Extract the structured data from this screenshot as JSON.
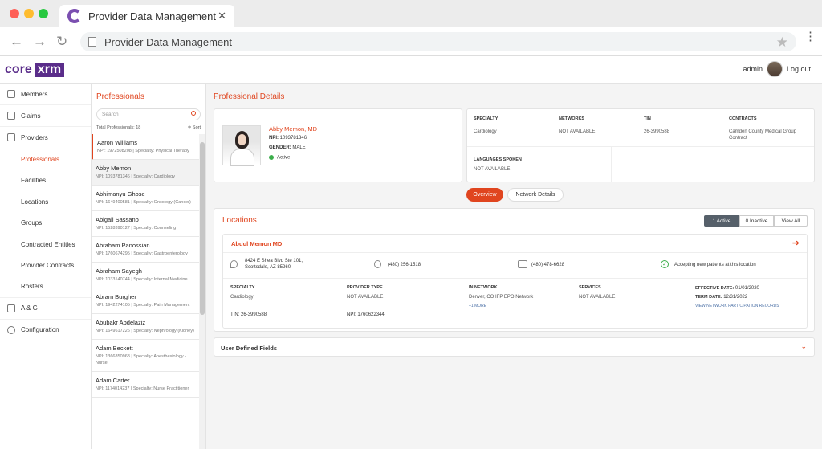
{
  "browser": {
    "tab_title": "Provider Data Management",
    "tab_close": "✕",
    "address": "Provider Data Management",
    "back": "←",
    "forward": "→",
    "reload": "↻",
    "star": "★",
    "menu": "⋮"
  },
  "header": {
    "brand_core": "core",
    "brand_xrm": "xrm",
    "user": "admin",
    "logout": "Log out"
  },
  "sidebar": {
    "members": "Members",
    "claims": "Claims",
    "providers": "Providers",
    "professionals": "Professionals",
    "facilities": "Facilities",
    "locations": "Locations",
    "groups": "Groups",
    "contracted_entities": "Contracted Entities",
    "provider_contracts": "Provider Contracts",
    "rosters": "Rosters",
    "a_and_g": "A & G",
    "configuration": "Configuration"
  },
  "professionals": {
    "title": "Professionals",
    "search_placeholder": "Search",
    "total": "Total Professionals: 18",
    "sort": "≑ Sort",
    "items": [
      {
        "name": "Aaron Williams",
        "meta": "NPI: 1972508208 | Specialty: Physical Therapy"
      },
      {
        "name": "Abby Memon",
        "meta": "NPI: 1093781346 | Specialty: Cardiology"
      },
      {
        "name": "Abhimanyu Ghose",
        "meta": "NPI: 1649400581 | Specialty: Oncology (Cancer)"
      },
      {
        "name": "Abigail Sassano",
        "meta": "NPI: 1528390127 | Specialty: Counseling"
      },
      {
        "name": "Abraham Panossian",
        "meta": "NPI: 1760674295 | Specialty: Gastroenterology"
      },
      {
        "name": "Abraham Sayegh",
        "meta": "NPI: 1033140744 | Specialty: Internal Medicine"
      },
      {
        "name": "Abram Burgher",
        "meta": "NPI: 1942274105 | Specialty: Pain Management"
      },
      {
        "name": "Abubakr Abdelaziz",
        "meta": "NPI: 1649617226 | Specialty: Nephrology (Kidney)"
      },
      {
        "name": "Adam Beckett",
        "meta": "NPI: 1366850968 | Specialty: Anesthesiology - Nurse"
      },
      {
        "name": "Adam Carter",
        "meta": "NPI: 1174014237 | Specialty: Nurse Practitioner"
      }
    ]
  },
  "details": {
    "title": "Professional Details",
    "name": "Abby Memon, MD",
    "npi_label": "NPI:",
    "npi": "1093781346",
    "gender_label": "GENDER:",
    "gender": "MALE",
    "status": "Active",
    "specialty_label": "SPECIALTY",
    "specialty": "Cardiology",
    "networks_label": "NETWORKS",
    "networks": "NOT AVAILABLE",
    "tin_label": "TIN",
    "tin": "26-3990588",
    "contracts_label": "CONTRACTS",
    "contracts": "Camden County Medical Group Contract",
    "languages_label": "LANGUAGES SPOKEN",
    "languages": "NOT AVAILABLE"
  },
  "tabs": {
    "overview": "Overview",
    "network_details": "Network Details"
  },
  "locations": {
    "title": "Locations",
    "filter_active": "1 Active",
    "filter_inactive": "0 Inactive",
    "filter_all": "View All",
    "name": "Abdul Memon MD",
    "arrow": "➔",
    "address_line1": "8424 E Shea Blvd Ste 101,",
    "address_line2": "Scottsdale, AZ 85260",
    "phone": "(480) 256-1518",
    "fax": "(480) 478-6628",
    "accepting": "Accepting new patients at this location",
    "specialty_label": "SPECIALTY",
    "specialty": "Cardiology",
    "provider_type_label": "PROVIDER TYPE",
    "provider_type": "NOT AVAILABLE",
    "in_network_label": "IN NETWORK",
    "in_network": "Denver, CO IFP EPO Network",
    "more": "+1 MORE",
    "services_label": "SERVICES",
    "services": "NOT AVAILABLE",
    "effective_label": "EFFECTIVE DATE:",
    "effective": "01/01/2020",
    "term_label": "TERM DATE:",
    "term": "12/31/2022",
    "records_link": "VIEW NETWORK PARTICIPATION RECORDS",
    "tin_label": "TIN:",
    "tin": "26-3990588",
    "npi_label": "NPI:",
    "npi": "1760622344"
  },
  "udf": {
    "label": "User Defined Fields",
    "chevron": "⌄"
  },
  "colors": {
    "accent": "#e0451f",
    "brand": "#5a2d8a",
    "active": "#3cae4b"
  }
}
